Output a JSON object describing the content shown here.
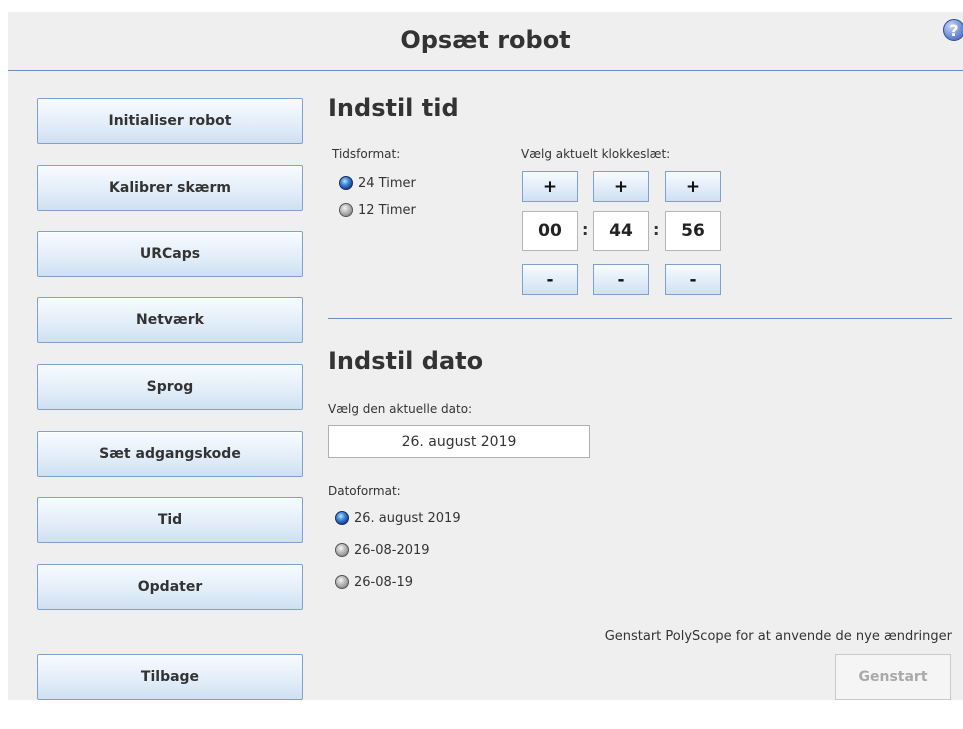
{
  "header": {
    "title": "Opsæt robot",
    "help_label": "?"
  },
  "sidebar": {
    "items": [
      {
        "label": "Initialiser robot"
      },
      {
        "label": "Kalibrer skærm"
      },
      {
        "label": "URCaps"
      },
      {
        "label": "Netværk"
      },
      {
        "label": "Sprog"
      },
      {
        "label": "Sæt adgangskode"
      },
      {
        "label": "Tid"
      },
      {
        "label": "Opdater"
      }
    ],
    "back_label": "Tilbage"
  },
  "time": {
    "heading": "Indstil tid",
    "format_label": "Tidsformat:",
    "formats": [
      {
        "label": "24 Timer",
        "selected": true
      },
      {
        "label": "12 Timer",
        "selected": false
      }
    ],
    "current_label": "Vælg aktuelt klokkeslæt:",
    "plus": "+",
    "minus": "-",
    "separator": ":",
    "hours": "00",
    "minutes": "44",
    "seconds": "56"
  },
  "date": {
    "heading": "Indstil dato",
    "current_label": "Vælg den aktuelle dato:",
    "value": "26. august 2019",
    "format_label": "Datoformat:",
    "formats": [
      {
        "label": "26. august 2019",
        "selected": true
      },
      {
        "label": "26-08-2019",
        "selected": false
      },
      {
        "label": "26-08-19",
        "selected": false
      }
    ]
  },
  "footer": {
    "note": "Genstart PolyScope for at anvende de nye ændringer",
    "restart_label": "Genstart"
  }
}
